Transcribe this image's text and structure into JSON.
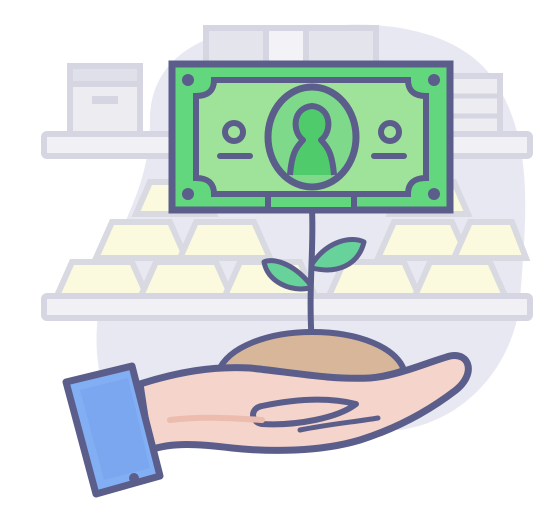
{
  "illustration": {
    "subject": "money-growth-illustration",
    "colors": {
      "outline": "#5b5e8a",
      "background_blob": "#e8e8f3",
      "shelf": "#e4e4ea",
      "boxes": "#ececf1",
      "gold_bar": "#fbfade",
      "gold_bar_shadow": "#f0ecc4",
      "banknote": "#63d77e",
      "banknote_inner": "#9fe39a",
      "banknote_shadow": "#4fcb6c",
      "leaf": "#67d29a",
      "stem": "#5b5e8a",
      "soil": "#d8b699",
      "hand": "#f4d4cb",
      "hand_shadow": "#ecbcae",
      "sleeve": "#82aef4",
      "sleeve_dark": "#6d9ae6",
      "button": "#5b5e8a"
    },
    "icons": [
      "banknote-icon",
      "gold-bar-icon",
      "plant-sprout-icon",
      "open-hand-icon",
      "shelf-icon",
      "storage-box-icon"
    ]
  }
}
